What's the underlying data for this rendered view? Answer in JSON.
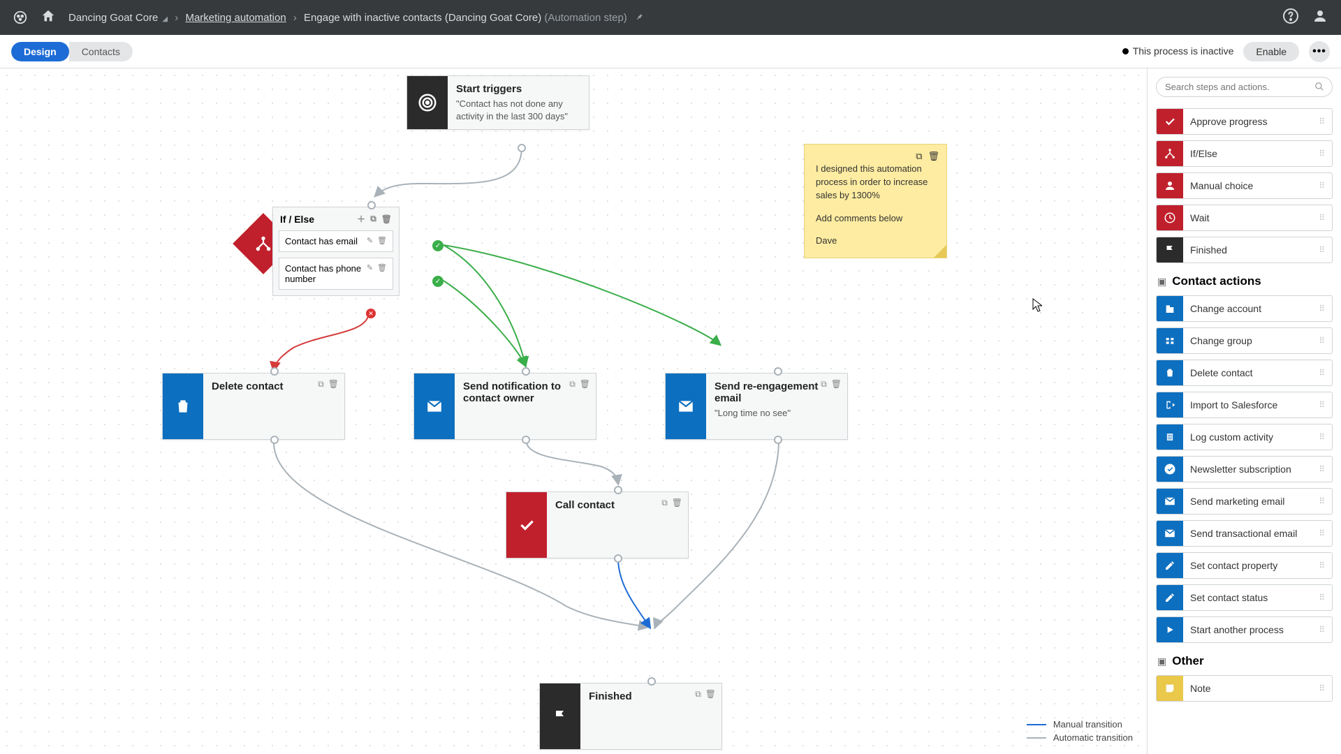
{
  "topbar": {
    "site": "Dancing Goat Core",
    "crumb_link": "Marketing automation",
    "crumb_page": "Engage with inactive contacts (Dancing Goat Core)",
    "crumb_suffix": "(Automation step)"
  },
  "toolbar": {
    "tab_design": "Design",
    "tab_contacts": "Contacts",
    "status": "This process is inactive",
    "enable": "Enable"
  },
  "nodes": {
    "start": {
      "title": "Start triggers",
      "desc": "\"Contact has not done any activity in the last 300 days\""
    },
    "ifelse": {
      "title": "If / Else",
      "cond1": "Contact has email",
      "cond2": "Contact has phone number"
    },
    "delete": {
      "title": "Delete contact"
    },
    "notify": {
      "title": "Send notification to contact owner"
    },
    "reengage": {
      "title": "Send re-engagement email",
      "desc": "\"Long time no see\""
    },
    "call": {
      "title": "Call contact"
    },
    "finished": {
      "title": "Finished"
    }
  },
  "sticky": {
    "line1": "I designed this automation process in order to increase sales by 1300%",
    "line2": "Add comments below",
    "line3": "Dave"
  },
  "legend": {
    "manual": "Manual transition",
    "auto": "Automatic transition"
  },
  "sidebar": {
    "search_placeholder": "Search steps and actions.",
    "flow": [
      {
        "label": "Approve progress",
        "color": "pi-red",
        "icon": "check"
      },
      {
        "label": "If/Else",
        "color": "pi-red",
        "icon": "branch"
      },
      {
        "label": "Manual choice",
        "color": "pi-red",
        "icon": "person"
      },
      {
        "label": "Wait",
        "color": "pi-red",
        "icon": "clock"
      },
      {
        "label": "Finished",
        "color": "pi-black",
        "icon": "flag"
      }
    ],
    "section_contact": "Contact actions",
    "contact": [
      {
        "label": "Change account",
        "icon": "building"
      },
      {
        "label": "Change group",
        "icon": "group"
      },
      {
        "label": "Delete contact",
        "icon": "trash"
      },
      {
        "label": "Import to Salesforce",
        "icon": "export"
      },
      {
        "label": "Log custom activity",
        "icon": "list"
      },
      {
        "label": "Newsletter subscription",
        "icon": "checkcircle"
      },
      {
        "label": "Send marketing email",
        "icon": "mail"
      },
      {
        "label": "Send transactional email",
        "icon": "mail"
      },
      {
        "label": "Set contact property",
        "icon": "pencil"
      },
      {
        "label": "Set contact status",
        "icon": "pencil"
      },
      {
        "label": "Start another process",
        "icon": "play"
      }
    ],
    "section_other": "Other",
    "other": [
      {
        "label": "Note",
        "icon": "note"
      }
    ]
  }
}
